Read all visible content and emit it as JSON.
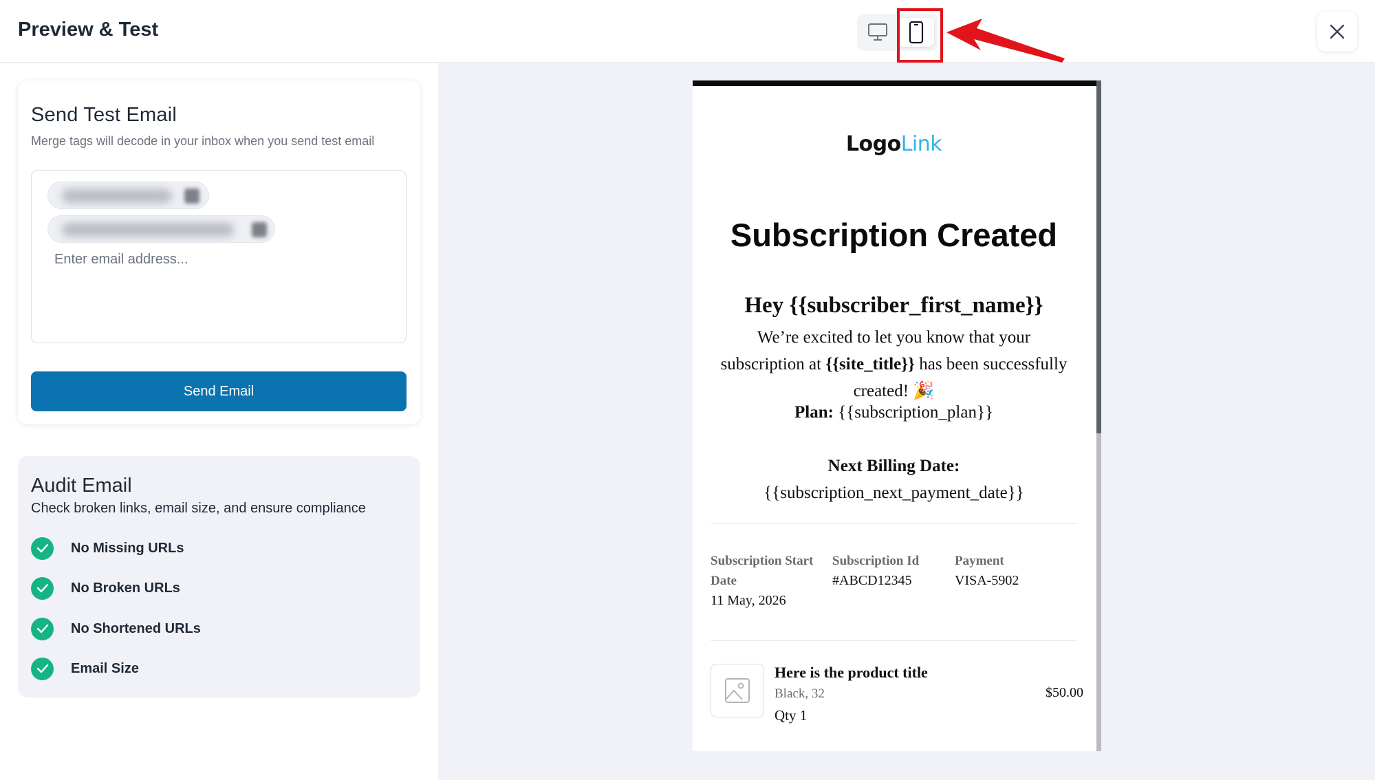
{
  "header": {
    "title": "Preview & Test",
    "device_toggle": {
      "active": "mobile",
      "options": [
        "desktop",
        "mobile"
      ]
    }
  },
  "send_test": {
    "title": "Send Test Email",
    "subtitle": "Merge tags will decode in your inbox when you send test email",
    "email_placeholder": "Enter email address...",
    "button_label": "Send Email"
  },
  "audit": {
    "title": "Audit Email",
    "subtitle": "Check broken links, email size, and ensure compliance",
    "items": [
      {
        "label": "No Missing URLs"
      },
      {
        "label": "No Broken URLs"
      },
      {
        "label": "No Shortened URLs"
      },
      {
        "label": "Email Size"
      }
    ]
  },
  "email": {
    "logo_dark": "Logo",
    "logo_light": "Link",
    "title": "Subscription Created",
    "greeting": "Hey {{subscriber_first_name}}",
    "body_before": "We’re excited to let you know that your subscription at ",
    "body_tag": "{{site_title}}",
    "body_after": " has been successfully created! 🎉",
    "plan_label": "Plan:",
    "plan_value": " {{subscription_plan}}",
    "next_billing_label": "Next Billing Date:",
    "next_billing_value": "{{subscription_next_payment_date}}",
    "meta": [
      {
        "label": "Subscription Start Date",
        "value": "11 May, 2026"
      },
      {
        "label": "Subscription Id",
        "value": "#ABCD12345"
      },
      {
        "label": "Payment",
        "value": "VISA-5902"
      }
    ],
    "product": {
      "title": "Here is the product title",
      "variant": "Black, 32",
      "qty": "Qty 1",
      "price": "$50.00"
    }
  },
  "colors": {
    "primary": "#0a73b0",
    "success": "#16b384",
    "highlight": "#e0141a",
    "logo_accent": "#2fb4ec"
  }
}
